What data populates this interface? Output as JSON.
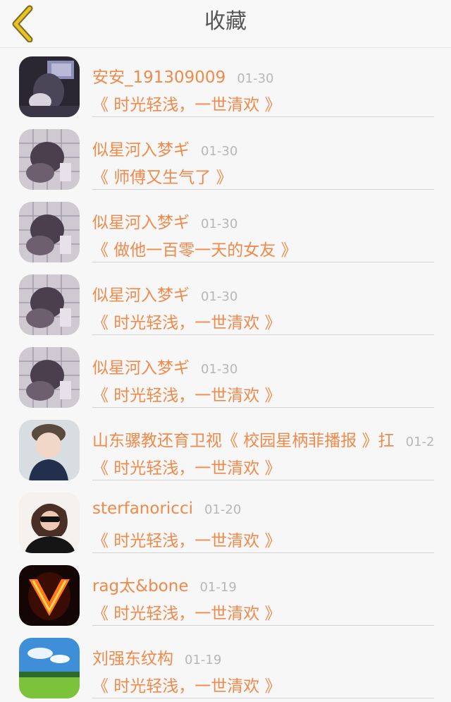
{
  "header": {
    "title": "收藏"
  },
  "colors": {
    "accent": "#f08a4b",
    "back_icon": "#e7c22a",
    "date": "#b7b7b7"
  },
  "items": [
    {
      "user": "安安_191309009",
      "date": "01-30",
      "work": "《 时光轻浅，一世清欢 》",
      "avatar": "dark-photo"
    },
    {
      "user": "似星河入梦ギ",
      "date": "01-30",
      "work": "《 师傅又生气了 》",
      "avatar": "grid-photo"
    },
    {
      "user": "似星河入梦ギ",
      "date": "01-30",
      "work": "《 做他一百零一天的女友 》",
      "avatar": "grid-photo"
    },
    {
      "user": "似星河入梦ギ",
      "date": "01-30",
      "work": "《 时光轻浅，一世清欢 》",
      "avatar": "grid-photo"
    },
    {
      "user": "似星河入梦ギ",
      "date": "01-30",
      "work": "《 时光轻浅，一世清欢 》",
      "avatar": "grid-photo"
    },
    {
      "user": "山东骡教还育卫视《 校园星柄菲播报 》扛",
      "date": "01-2",
      "work": "《 时光轻浅，一世清欢 》",
      "avatar": "child-photo"
    },
    {
      "user": "sterfanoricci",
      "date": "01-20",
      "work": "《 时光轻浅，一世清欢 》",
      "avatar": "sunglasses-photo"
    },
    {
      "user": "rag太&bone",
      "date": "01-19",
      "work": "《 时光轻浅，一世清欢 》",
      "avatar": "fire-v-logo"
    },
    {
      "user": "刘强东纹构",
      "date": "01-19",
      "work": "《 时光轻浅，一世清欢 》",
      "avatar": "landscape-photo"
    }
  ]
}
